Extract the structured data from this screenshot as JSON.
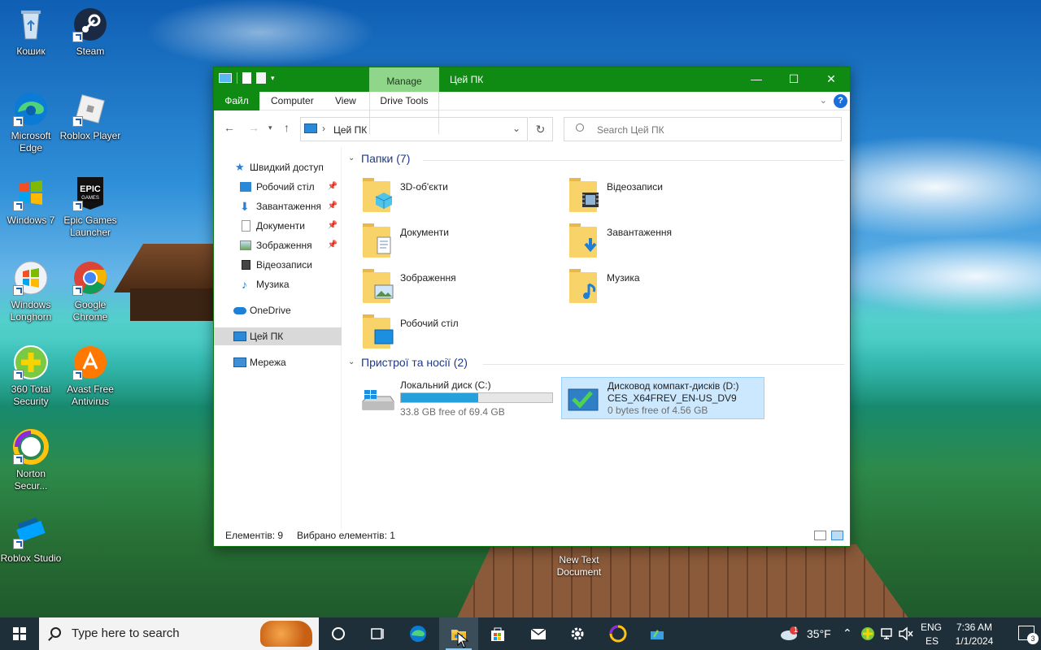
{
  "desktop": {
    "icons": [
      {
        "label": "Кошик"
      },
      {
        "label": "Steam"
      },
      {
        "label": "Microsoft Edge"
      },
      {
        "label": "Roblox Player"
      },
      {
        "label": "Windows 7"
      },
      {
        "label": "Epic Games Launcher"
      },
      {
        "label": "Windows Longhorn"
      },
      {
        "label": "Google Chrome"
      },
      {
        "label": "360 Total Security"
      },
      {
        "label": "Avast Free Antivirus"
      },
      {
        "label": "Norton Secur..."
      },
      {
        "label": "Roblox Studio"
      }
    ],
    "file": {
      "label": "New Text Document"
    },
    "epic_icon_text": "EPIC",
    "epic_icon_subtext": "GAMES"
  },
  "window": {
    "title": "Цей ПК",
    "manage_tab": "Manage",
    "controls": {
      "minimize": "—",
      "maximize": "☐",
      "close": "✕"
    },
    "ribbon": {
      "file": "Файл",
      "computer": "Computer",
      "view": "View",
      "drive_tools": "Drive Tools",
      "help": "?"
    },
    "address": {
      "path": "Цей ПК",
      "search_placeholder": "Search Цей ПК"
    },
    "nav": [
      {
        "label": "Швидкий доступ",
        "pinned": false
      },
      {
        "label": "Робочий стіл",
        "pinned": true
      },
      {
        "label": "Завантаження",
        "pinned": true
      },
      {
        "label": "Документи",
        "pinned": true
      },
      {
        "label": "Зображення",
        "pinned": true
      },
      {
        "label": "Відеозаписи",
        "pinned": false
      },
      {
        "label": "Музика",
        "pinned": false
      },
      {
        "label": "OneDrive",
        "pinned": false
      },
      {
        "label": "Цей ПК",
        "pinned": false,
        "selected": true
      },
      {
        "label": "Мережа",
        "pinned": false
      }
    ],
    "folders_header": "Папки (7)",
    "folders": [
      {
        "label": "3D-об'єкти"
      },
      {
        "label": "Відеозаписи"
      },
      {
        "label": "Документи"
      },
      {
        "label": "Завантаження"
      },
      {
        "label": "Зображення"
      },
      {
        "label": "Музика"
      },
      {
        "label": "Робочий стіл"
      }
    ],
    "devices_header": "Пристрої та носії (2)",
    "drives": [
      {
        "name": "Локальний диск (C:)",
        "free": "33.8 GB free of 69.4 GB",
        "used_fraction": 0.51
      },
      {
        "name": "Дисковод компакт-дисків (D:)",
        "sub": "CES_X64FREV_EN-US_DV9",
        "free": "0 bytes free of 4.56 GB",
        "selected": true
      }
    ],
    "status": {
      "count": "Елементів: 9",
      "selected": "Вибрано елементів: 1"
    }
  },
  "taskbar": {
    "search_placeholder": "Type here to search",
    "weather": "35°F",
    "lang_top": "ENG",
    "lang_bottom": "ES",
    "time": "7:36 AM",
    "date": "1/1/2024",
    "notifications": "3",
    "weather_badge": "1"
  }
}
